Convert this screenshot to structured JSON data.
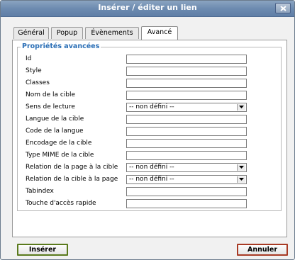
{
  "window": {
    "title": "Insérer / éditer un lien"
  },
  "tabs": [
    {
      "label": "Général"
    },
    {
      "label": "Popup"
    },
    {
      "label": "Évènements"
    },
    {
      "label": "Avancé"
    }
  ],
  "fieldset": {
    "legend": "Propriétés avancées"
  },
  "fields": [
    {
      "label": "Id",
      "type": "text",
      "value": ""
    },
    {
      "label": "Style",
      "type": "text",
      "value": ""
    },
    {
      "label": "Classes",
      "type": "text",
      "value": ""
    },
    {
      "label": "Nom de la cible",
      "type": "text",
      "value": ""
    },
    {
      "label": "Sens de lecture",
      "type": "select",
      "value": "-- non défini --"
    },
    {
      "label": "Langue de la cible",
      "type": "text",
      "value": ""
    },
    {
      "label": "Code de la langue",
      "type": "text",
      "value": ""
    },
    {
      "label": "Encodage de la cible",
      "type": "text",
      "value": ""
    },
    {
      "label": "Type MIME de la cible",
      "type": "text",
      "value": ""
    },
    {
      "label": "Relation de la page à la cible",
      "type": "select",
      "value": "-- non défini --"
    },
    {
      "label": "Relation de la cible à la page",
      "type": "select",
      "value": "-- non défini --"
    },
    {
      "label": "Tabindex",
      "type": "text",
      "value": ""
    },
    {
      "label": "Touche d'accès rapide",
      "type": "text",
      "value": ""
    }
  ],
  "buttons": {
    "insert_label": "Insérer",
    "cancel_label": "Annuler"
  },
  "colors": {
    "legend": "#2b6fb6",
    "insert_border": "#5a7a1c",
    "cancel_border": "#a83a24",
    "titlebar": "#6d8bb0"
  }
}
